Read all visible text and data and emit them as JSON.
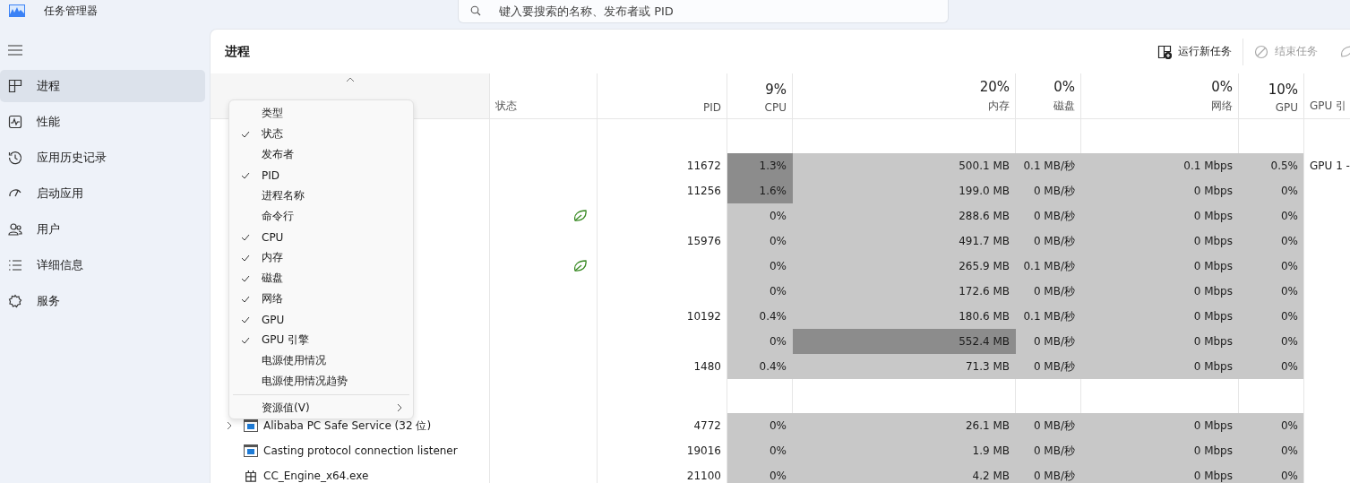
{
  "window": {
    "title": "任务管理器"
  },
  "search": {
    "placeholder": "键入要搜索的名称、发布者或 PID"
  },
  "sidebar": {
    "items": [
      {
        "label": "进程",
        "selected": true
      },
      {
        "label": "性能",
        "selected": false
      },
      {
        "label": "应用历史记录",
        "selected": false
      },
      {
        "label": "启动应用",
        "selected": false
      },
      {
        "label": "用户",
        "selected": false
      },
      {
        "label": "详细信息",
        "selected": false
      },
      {
        "label": "服务",
        "selected": false
      }
    ]
  },
  "page": {
    "title": "进程"
  },
  "toolbar": [
    {
      "label": "运行新任务",
      "kind": "run",
      "disabled": false
    },
    {
      "label": "结束任务",
      "kind": "end",
      "disabled": true
    },
    {
      "kind": "efficiency",
      "disabled": true
    }
  ],
  "table": {
    "columns": [
      {
        "label": "状态"
      },
      {
        "label": "PID"
      },
      {
        "percent": "9%",
        "label": "CPU"
      },
      {
        "percent": "20%",
        "label": "内存"
      },
      {
        "percent": "0%",
        "label": "磁盘"
      },
      {
        "percent": "0%",
        "label": "网络"
      },
      {
        "percent": "10%",
        "label": "GPU"
      },
      {
        "label": "GPU 引"
      }
    ],
    "rows": [
      {
        "kind": "group"
      },
      {
        "kind": "process",
        "pid": "11672",
        "eco": false,
        "cpu": "1.3%",
        "cpu_high": true,
        "memory": "500.1 MB",
        "memory_high": false,
        "disk": "0.1 MB/秒",
        "network": "0.1 Mbps",
        "gpu": "0.5%",
        "gpu_engine": "GPU 1 -"
      },
      {
        "kind": "process",
        "pid": "11256",
        "eco": false,
        "cpu": "1.6%",
        "cpu_high": true,
        "memory": "199.0 MB",
        "memory_high": false,
        "disk": "0 MB/秒",
        "network": "0 Mbps",
        "gpu": "0%"
      },
      {
        "kind": "process",
        "eco": true,
        "cpu": "0%",
        "cpu_high": false,
        "memory": "288.6 MB",
        "memory_high": false,
        "disk": "0 MB/秒",
        "network": "0 Mbps",
        "gpu": "0%"
      },
      {
        "kind": "process",
        "pid": "15976",
        "eco": false,
        "cpu": "0%",
        "cpu_high": false,
        "memory": "491.7 MB",
        "memory_high": false,
        "disk": "0 MB/秒",
        "network": "0 Mbps",
        "gpu": "0%"
      },
      {
        "kind": "process",
        "eco": true,
        "cpu": "0%",
        "cpu_high": false,
        "memory": "265.9 MB",
        "memory_high": false,
        "disk": "0.1 MB/秒",
        "network": "0 Mbps",
        "gpu": "0%"
      },
      {
        "kind": "process",
        "eco": false,
        "cpu": "0%",
        "cpu_high": false,
        "memory": "172.6 MB",
        "memory_high": false,
        "disk": "0 MB/秒",
        "network": "0 Mbps",
        "gpu": "0%"
      },
      {
        "kind": "process",
        "pid": "10192",
        "eco": false,
        "cpu": "0.4%",
        "cpu_high": false,
        "memory": "180.6 MB",
        "memory_high": false,
        "disk": "0.1 MB/秒",
        "network": "0 Mbps",
        "gpu": "0%"
      },
      {
        "kind": "process",
        "eco": false,
        "cpu": "0%",
        "cpu_high": false,
        "memory": "552.4 MB",
        "memory_high": true,
        "disk": "0 MB/秒",
        "network": "0 Mbps",
        "gpu": "0%"
      },
      {
        "kind": "process",
        "pid": "1480",
        "eco": false,
        "cpu": "0.4%",
        "cpu_high": false,
        "memory": "71.3 MB",
        "memory_high": false,
        "disk": "0 MB/秒",
        "network": "0 Mbps",
        "gpu": "0%"
      },
      {
        "kind": "group"
      },
      {
        "kind": "process",
        "name": "Alibaba PC Safe Service (32 位)",
        "expandable": true,
        "pid": "4772",
        "eco": false,
        "cpu": "0%",
        "cpu_high": false,
        "memory": "26.1 MB",
        "memory_high": false,
        "disk": "0 MB/秒",
        "network": "0 Mbps",
        "gpu": "0%"
      },
      {
        "kind": "process",
        "name": "Casting protocol connection listener",
        "expandable": false,
        "pid": "19016",
        "eco": false,
        "cpu": "0%",
        "cpu_high": false,
        "memory": "1.9 MB",
        "memory_high": false,
        "disk": "0 MB/秒",
        "network": "0 Mbps",
        "gpu": "0%"
      },
      {
        "kind": "program",
        "name": "CC_Engine_x64.exe",
        "expandable": false,
        "pid": "21100",
        "eco": false,
        "cpu": "0%",
        "cpu_high": false,
        "memory": "4.2 MB",
        "memory_high": false,
        "disk": "0 MB/秒",
        "network": "0 Mbps",
        "gpu": "0%"
      }
    ]
  },
  "column_menu": {
    "items": [
      {
        "label": "类型",
        "checked": false
      },
      {
        "label": "状态",
        "checked": true
      },
      {
        "label": "发布者",
        "checked": false
      },
      {
        "label": "PID",
        "checked": true
      },
      {
        "label": "进程名称",
        "checked": false
      },
      {
        "label": "命令行",
        "checked": false
      },
      {
        "label": "CPU",
        "checked": true
      },
      {
        "label": "内存",
        "checked": true
      },
      {
        "label": "磁盘",
        "checked": true
      },
      {
        "label": "网络",
        "checked": true
      },
      {
        "label": "GPU",
        "checked": true
      },
      {
        "label": "GPU 引擎",
        "checked": true
      },
      {
        "label": "电源使用情况",
        "checked": false
      },
      {
        "label": "电源使用情况趋势",
        "checked": false
      }
    ],
    "submenu": {
      "label": "资源值(V)"
    }
  }
}
